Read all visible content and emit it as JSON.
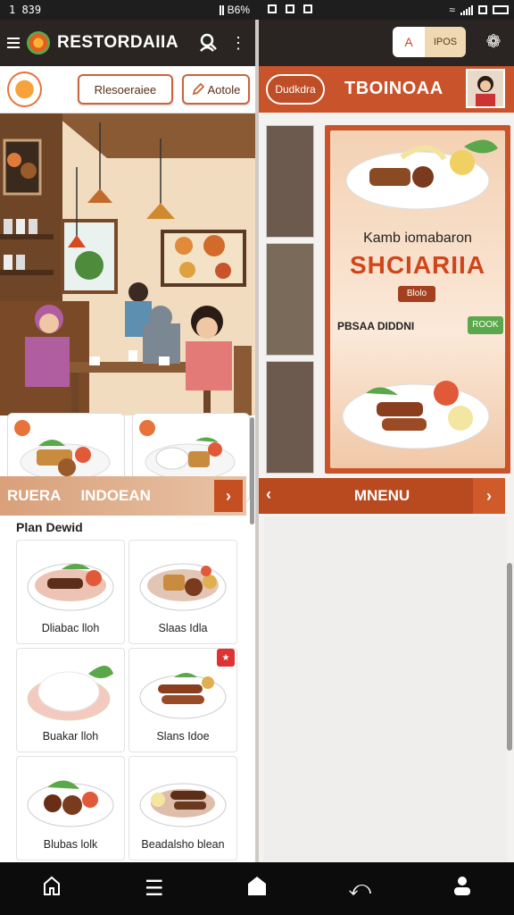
{
  "status_left": {
    "time": "1 839",
    "right_text": "B6%"
  },
  "left": {
    "app_title": "RESTORDAIIA",
    "btn_reservasi": "Rlesoeraiee",
    "btn_action": "Aotole",
    "strip_label_1": "RUERA",
    "strip_label_2": "INDOEAN",
    "plan_title": "Plan Dewid",
    "dishes": [
      {
        "name": "Dliabac lloh"
      },
      {
        "name": "Slaas Idla"
      },
      {
        "name": "Buakar lloh"
      },
      {
        "name": "Slans Idoe"
      },
      {
        "name": "Blubas lolk"
      },
      {
        "name": "Beadalsho blean"
      }
    ]
  },
  "right": {
    "seg_a": "A",
    "seg_b": "IPOS",
    "chip": "Dudkdra",
    "title": "TBOINOAA",
    "poster_kicker": "Kamb iomabaron",
    "poster_title": "SHCIARIIA",
    "poster_btn": "Blolo",
    "poster_name": "PBSAA DIDDNI",
    "poster_price": "ROOK",
    "nav_label": "MNENU"
  },
  "icons": [
    "menu-icon",
    "logo-icon",
    "user-search-icon",
    "more-icon",
    "edit-icon",
    "puzzle-icon",
    "home-outline-icon",
    "list-icon",
    "home-filled-icon",
    "back-icon",
    "profile-icon"
  ],
  "colors": {
    "accent": "#c9532a",
    "dark": "#2a2522",
    "green": "#5aa84b"
  }
}
